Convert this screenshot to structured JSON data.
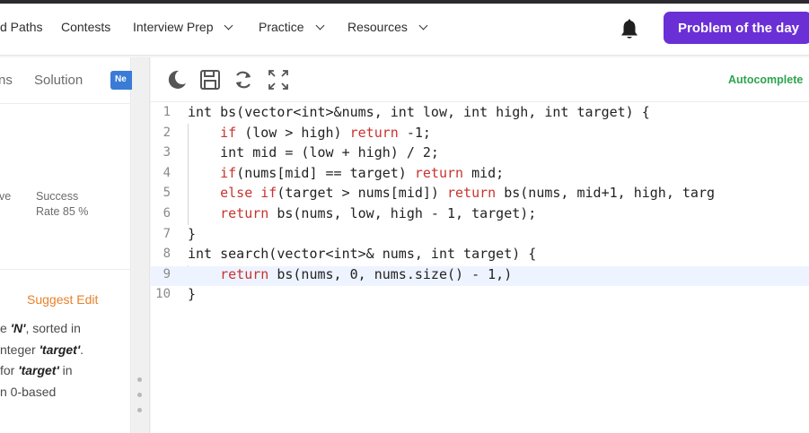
{
  "nav": {
    "items": [
      {
        "label": "d Paths",
        "has_chevron": false
      },
      {
        "label": "Contests",
        "has_chevron": false
      },
      {
        "label": "Interview Prep",
        "has_chevron": true
      },
      {
        "label": "Practice",
        "has_chevron": true
      },
      {
        "label": "Resources",
        "has_chevron": true
      }
    ],
    "bell_icon": "bell-icon",
    "potd_label": "Problem of the day",
    "potd_color": "#6b2fd6"
  },
  "left_panel": {
    "tabs": [
      "ns",
      "Solution"
    ],
    "new_badge": "Ne",
    "stat_left": "ve",
    "stat_label_1": "Success",
    "stat_label_2": "Rate 85 %",
    "suggest_edit": "Suggest Edit",
    "description": [
      {
        "pre": "e ",
        "em": "'N'",
        "post": ", sorted in"
      },
      {
        "pre": "nteger ",
        "em": "'target'",
        "post": "."
      },
      {
        "pre": " for ",
        "em": "'target'",
        "post": " in"
      },
      {
        "pre": "n 0-based",
        "em": "",
        "post": ""
      }
    ]
  },
  "editor": {
    "toolbar_icons": [
      "moon-icon",
      "save-icon",
      "refresh-icon",
      "fullscreen-icon"
    ],
    "autocomplete_label": "Autocomplete",
    "autocomplete_color": "#2ea44f",
    "lines": [
      {
        "n": "1",
        "code": "int bs(vector<int>&nums, int low, int high, int target) {"
      },
      {
        "n": "2",
        "code": "    if (low > high) return -1;"
      },
      {
        "n": "3",
        "code": "    int mid = (low + high) / 2;"
      },
      {
        "n": "4",
        "code": "    if(nums[mid] == target) return mid;"
      },
      {
        "n": "5",
        "code": "    else if(target > nums[mid]) return bs(nums, mid+1, high, targ"
      },
      {
        "n": "6",
        "code": "    return bs(nums, low, high - 1, target);"
      },
      {
        "n": "7",
        "code": "}"
      },
      {
        "n": "8",
        "code": "int search(vector<int>& nums, int target) {"
      },
      {
        "n": "9",
        "code": "    return bs(nums, 0, nums.size() - 1,)"
      },
      {
        "n": "10",
        "code": "}"
      }
    ]
  }
}
